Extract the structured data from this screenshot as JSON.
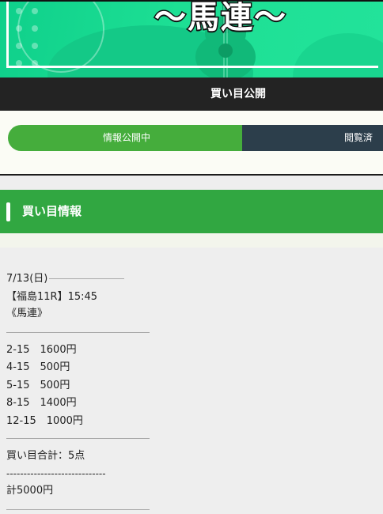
{
  "hero": {
    "title": "〜馬連〜"
  },
  "header": {
    "title": "買い目公開"
  },
  "status": {
    "active_label": "情報公開中",
    "viewed_label": "閲覧済"
  },
  "section": {
    "title": "買い目情報"
  },
  "race": {
    "date": "7/13(日)",
    "race_info": "【福島11R】15:45",
    "bet_type": "《馬連》"
  },
  "bets": [
    "2-15　1600円",
    "4-15　500円",
    "5-15　500円",
    "8-15　1400円",
    "12-15　1000円"
  ],
  "summary": {
    "count": "買い目合計：5点",
    "dashes": "-----------------------------",
    "total": "計5000円"
  }
}
